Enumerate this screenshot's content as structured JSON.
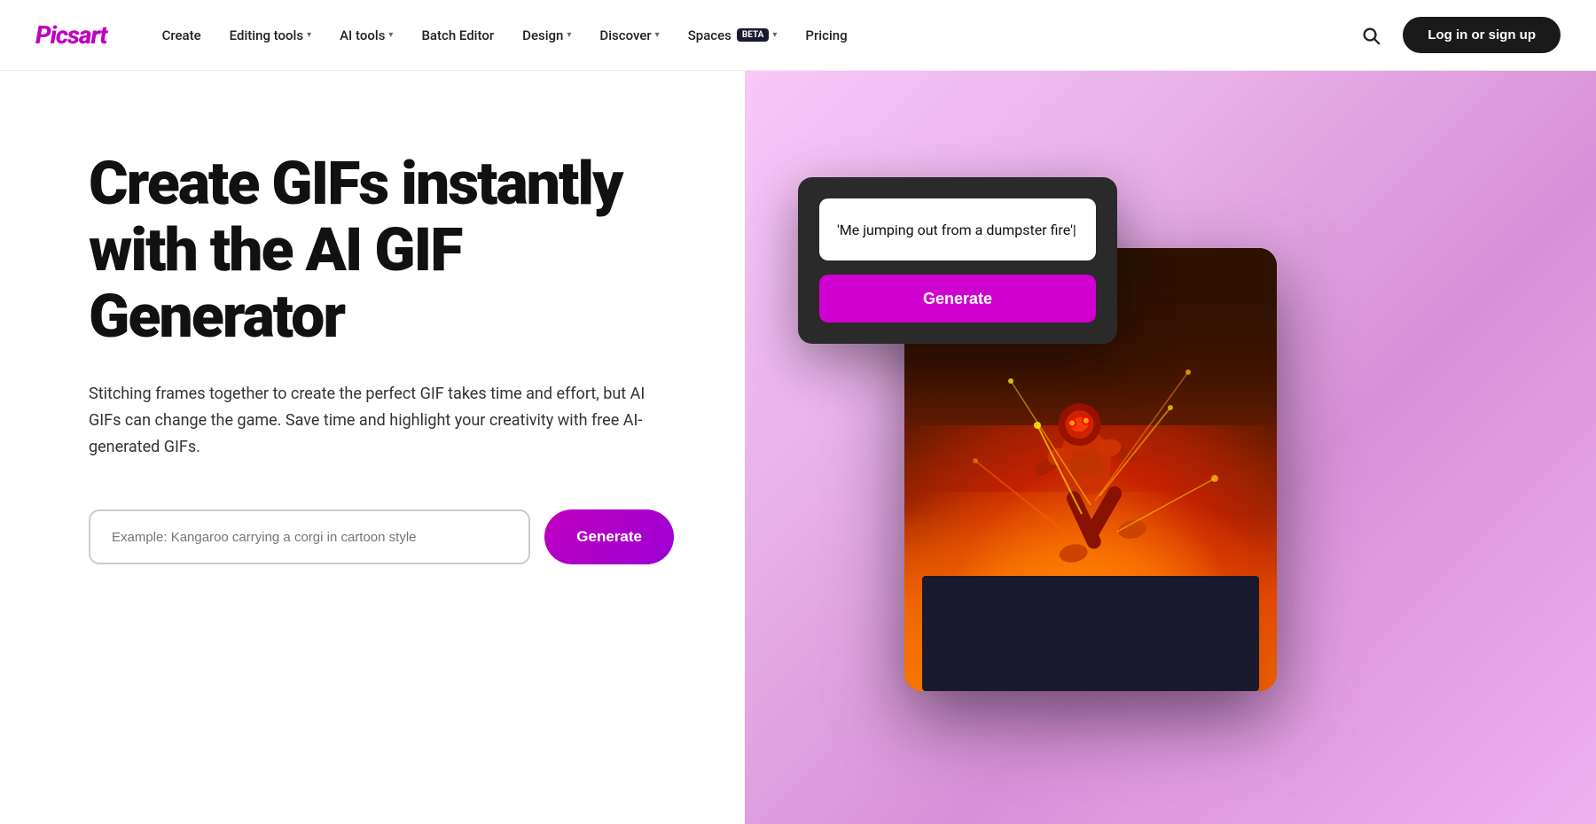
{
  "logo": {
    "text": "Picsart"
  },
  "nav": {
    "links": [
      {
        "label": "Create",
        "hasDropdown": false
      },
      {
        "label": "Editing tools",
        "hasDropdown": true
      },
      {
        "label": "AI tools",
        "hasDropdown": true
      },
      {
        "label": "Batch Editor",
        "hasDropdown": false
      },
      {
        "label": "Design",
        "hasDropdown": true
      },
      {
        "label": "Discover",
        "hasDropdown": true
      },
      {
        "label": "Spaces",
        "hasDropdown": true,
        "badge": "BETA"
      },
      {
        "label": "Pricing",
        "hasDropdown": false
      }
    ],
    "loginLabel": "Log in or sign up"
  },
  "hero": {
    "title": "Create GIFs instantly with the AI GIF Generator",
    "description": "Stitching frames together to create the perfect GIF takes time and effort, but AI GIFs can change the game. Save time and highlight your creativity with free AI-generated GIFs.",
    "inputPlaceholder": "Example: Kangaroo carrying a corgi in cartoon style",
    "generateLabel": "Generate"
  },
  "aiCard": {
    "promptText": "'Me jumping out from a dumpster fire'|",
    "generateLabel": "Generate"
  },
  "colors": {
    "brand": "#c000c0",
    "darkBtn": "#1a1a1a",
    "gradient_start": "#f8c8f8",
    "gradient_end": "#d890d8"
  }
}
